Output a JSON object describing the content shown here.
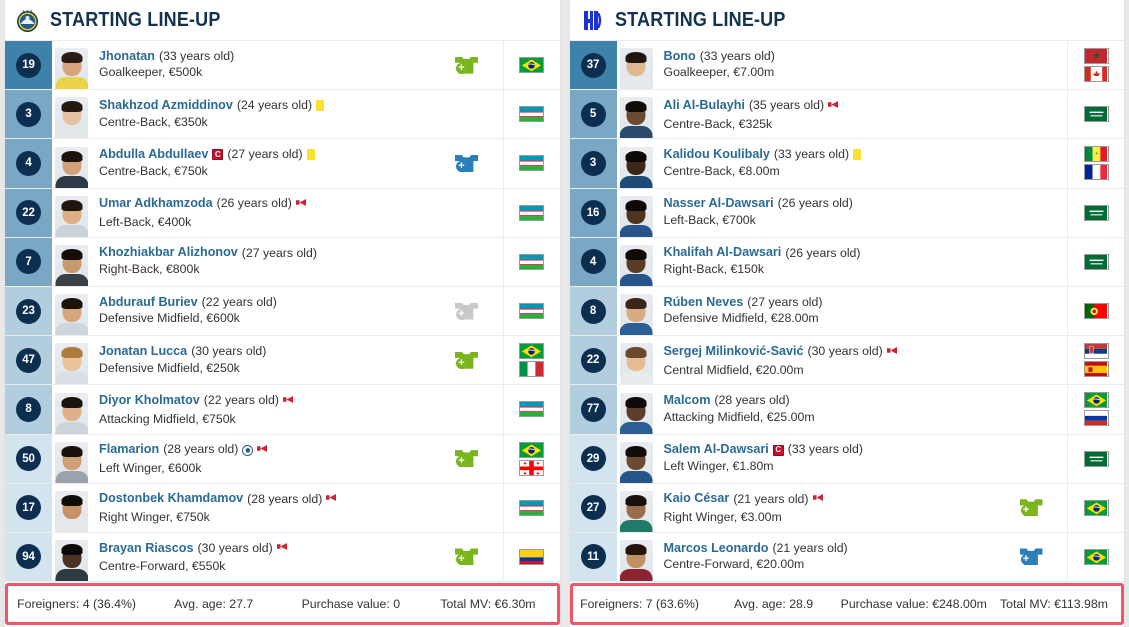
{
  "left_team": {
    "title": "STARTING LINE-UP",
    "crest_icon": "pakhtakor-crest-icon",
    "players": [
      {
        "number": "19",
        "name": "Jhonatan",
        "age": "(33 years old)",
        "position": "Goalkeeper, €500k",
        "pos_group": "gk",
        "sub": "in",
        "flags": [
          "br"
        ],
        "captain": false,
        "yellow": false,
        "arrow": false,
        "goal": false,
        "skin": "#d8a27a",
        "hair": "#2a1c14",
        "shirt": "#e8d34a"
      },
      {
        "number": "3",
        "name": "Shakhzod Azmiddinov",
        "age": "(24 years old)",
        "position": "Centre-Back, €350k",
        "pos_group": "def",
        "sub": null,
        "flags": [
          "uz"
        ],
        "captain": false,
        "yellow": true,
        "arrow": false,
        "goal": false,
        "skin": "#e6c3a0",
        "hair": "#241a12",
        "shirt": "#e2e7ea"
      },
      {
        "number": "4",
        "name": "Abdulla Abdullaev",
        "age": "(27 years old)",
        "position": "Centre-Back, €750k",
        "pos_group": "def",
        "sub": "out",
        "flags": [
          "uz"
        ],
        "captain": true,
        "yellow": true,
        "arrow": false,
        "goal": false,
        "skin": "#d3a079",
        "hair": "#1d140d",
        "shirt": "#2d3a46"
      },
      {
        "number": "22",
        "name": "Umar Adkhamzoda",
        "age": "(26 years old)",
        "position": "Left-Back, €400k",
        "pos_group": "def",
        "sub": null,
        "flags": [
          "uz"
        ],
        "captain": false,
        "yellow": false,
        "arrow": true,
        "goal": false,
        "skin": "#dcae85",
        "hair": "#20160f",
        "shirt": "#c9d2d8"
      },
      {
        "number": "7",
        "name": "Khozhiakbar Alizhonov",
        "age": "(27 years old)",
        "position": "Right-Back, €800k",
        "pos_group": "def",
        "sub": null,
        "flags": [
          "uz"
        ],
        "captain": false,
        "yellow": false,
        "arrow": false,
        "goal": false,
        "skin": "#c99a70",
        "hair": "#140d08",
        "shirt": "#3a3f45"
      },
      {
        "number": "23",
        "name": "Abdurauf Buriev",
        "age": "(22 years old)",
        "position": "Defensive Midfield, €600k",
        "pos_group": "mid",
        "sub": "gray",
        "flags": [
          "uz"
        ],
        "captain": false,
        "yellow": false,
        "arrow": false,
        "goal": false,
        "skin": "#d6a57c",
        "hair": "#1a1109",
        "shirt": "#cfd6db"
      },
      {
        "number": "47",
        "name": "Jonatan Lucca",
        "age": "(30 years old)",
        "position": "Defensive Midfield, €250k",
        "pos_group": "mid",
        "sub": "in",
        "flags": [
          "br",
          "it"
        ],
        "captain": false,
        "yellow": false,
        "arrow": false,
        "goal": false,
        "skin": "#e8c39c",
        "hair": "#b07a3c",
        "shirt": "#d9dfe4"
      },
      {
        "number": "8",
        "name": "Diyor Kholmatov",
        "age": "(22 years old)",
        "position": "Attacking Midfield, €750k",
        "pos_group": "mid",
        "sub": null,
        "flags": [
          "uz"
        ],
        "captain": false,
        "yellow": false,
        "arrow": true,
        "goal": false,
        "skin": "#dfb189",
        "hair": "#1b120b",
        "shirt": "#cdd5da"
      },
      {
        "number": "50",
        "name": "Flamarion",
        "age": "(28 years old)",
        "position": "Left Winger, €600k",
        "pos_group": "att",
        "sub": "in",
        "flags": [
          "br",
          "ge"
        ],
        "captain": false,
        "yellow": false,
        "arrow": true,
        "goal": true,
        "skin": "#cf9f76",
        "hair": "#171008",
        "shirt": "#9aa3ab"
      },
      {
        "number": "17",
        "name": "Dostonbek Khamdamov",
        "age": "(28 years old)",
        "position": "Right Winger, €750k",
        "pos_group": "att",
        "sub": null,
        "flags": [
          "uz"
        ],
        "captain": false,
        "yellow": false,
        "arrow": true,
        "goal": false,
        "skin": "#c79168",
        "hair": "#120c06",
        "shirt": "#e5e9ec"
      },
      {
        "number": "94",
        "name": "Brayan Riascos",
        "age": "(30 years old)",
        "position": "Centre-Forward, €550k",
        "pos_group": "att",
        "sub": "in",
        "flags": [
          "co"
        ],
        "captain": false,
        "yellow": false,
        "arrow": true,
        "goal": false,
        "skin": "#4a3225",
        "hair": "#0d0805",
        "shirt": "#2e3940"
      }
    ],
    "footer": {
      "foreigners": "Foreigners: 4 (36.4%)",
      "avg_age": "Avg. age: 27.7",
      "purchase_value": "Purchase value: 0",
      "total_mv": "Total MV: €6.30m"
    }
  },
  "right_team": {
    "title": "STARTING LINE-UP",
    "crest_icon": "al-hilal-crest-icon",
    "players": [
      {
        "number": "37",
        "name": "Bono",
        "age": "(33 years old)",
        "position": "Goalkeeper, €7.00m",
        "pos_group": "gk",
        "sub": null,
        "flags": [
          "ma",
          "ca"
        ],
        "captain": false,
        "yellow": false,
        "arrow": false,
        "goal": false,
        "skin": "#e0b88f",
        "hair": "#211710",
        "shirt": "#e6eaec"
      },
      {
        "number": "5",
        "name": "Ali Al-Bulayhi",
        "age": "(35 years old)",
        "position": "Centre-Back, €325k",
        "pos_group": "def",
        "sub": null,
        "flags": [
          "sa"
        ],
        "captain": false,
        "yellow": false,
        "arrow": true,
        "goal": false,
        "skin": "#6b4a34",
        "hair": "#120c07",
        "shirt": "#2a4a6b"
      },
      {
        "number": "3",
        "name": "Kalidou Koulibaly",
        "age": "(33 years old)",
        "position": "Centre-Back, €8.00m",
        "pos_group": "def",
        "sub": null,
        "flags": [
          "sn",
          "fr"
        ],
        "captain": false,
        "yellow": true,
        "arrow": false,
        "goal": false,
        "skin": "#3b2719",
        "hair": "#0b0704",
        "shirt": "#1f4b7a"
      },
      {
        "number": "16",
        "name": "Nasser Al-Dawsari",
        "age": "(26 years old)",
        "position": "Left-Back, €700k",
        "pos_group": "def",
        "sub": null,
        "flags": [
          "sa"
        ],
        "captain": false,
        "yellow": false,
        "arrow": false,
        "goal": false,
        "skin": "#4e3522",
        "hair": "#0d0805",
        "shirt": "#27558a"
      },
      {
        "number": "4",
        "name": "Khalifah Al-Dawsari",
        "age": "(26 years old)",
        "position": "Right-Back, €150k",
        "pos_group": "def",
        "sub": null,
        "flags": [
          "sa"
        ],
        "captain": false,
        "yellow": false,
        "arrow": false,
        "goal": false,
        "skin": "#5a3c26",
        "hair": "#100a06",
        "shirt": "#27558a"
      },
      {
        "number": "8",
        "name": "Rúben Neves",
        "age": "(27 years old)",
        "position": "Defensive Midfield, €28.00m",
        "pos_group": "mid",
        "sub": null,
        "flags": [
          "pt"
        ],
        "captain": false,
        "yellow": false,
        "arrow": false,
        "goal": false,
        "skin": "#d8ab83",
        "hair": "#3a2516",
        "shirt": "#2a5e94"
      },
      {
        "number": "22",
        "name": "Sergej Milinković-Savić",
        "age": "(30 years old)",
        "position": "Central Midfield, €20.00m",
        "pos_group": "mid",
        "sub": null,
        "flags": [
          "rs",
          "es"
        ],
        "captain": false,
        "yellow": false,
        "arrow": true,
        "goal": false,
        "skin": "#e4bd95",
        "hair": "#6a4a2c",
        "shirt": "#e8ecee"
      },
      {
        "number": "77",
        "name": "Malcom",
        "age": "(28 years old)",
        "position": "Attacking Midfield, €25.00m",
        "pos_group": "mid",
        "sub": null,
        "flags": [
          "br",
          "ru"
        ],
        "captain": false,
        "yellow": false,
        "arrow": false,
        "goal": false,
        "skin": "#5c3e28",
        "hair": "#0f0a06",
        "shirt": "#2a5e94"
      },
      {
        "number": "29",
        "name": "Salem Al-Dawsari",
        "age": "(33 years old)",
        "position": "Left Winger, €1.80m",
        "pos_group": "att",
        "sub": null,
        "flags": [
          "sa"
        ],
        "captain": true,
        "yellow": false,
        "arrow": false,
        "goal": false,
        "skin": "#6d4a30",
        "hair": "#120c07",
        "shirt": "#27558a"
      },
      {
        "number": "27",
        "name": "Kaio César",
        "age": "(21 years old)",
        "position": "Right Winger, €3.00m",
        "pos_group": "att",
        "sub": "in",
        "flags": [
          "br"
        ],
        "captain": false,
        "yellow": false,
        "arrow": true,
        "goal": false,
        "skin": "#9a6d4a",
        "hair": "#16100a",
        "shirt": "#1f7a6a"
      },
      {
        "number": "11",
        "name": "Marcos Leonardo",
        "age": "(21 years old)",
        "position": "Centre-Forward, €20.00m",
        "pos_group": "att",
        "sub": "out",
        "flags": [
          "br"
        ],
        "captain": false,
        "yellow": false,
        "arrow": false,
        "goal": false,
        "skin": "#c08f63",
        "hair": "#241409",
        "shirt": "#8a2430"
      }
    ],
    "footer": {
      "foreigners": "Foreigners: 7 (63.6%)",
      "avg_age": "Avg. age: 28.9",
      "purchase_value": "Purchase value: €248.00m",
      "total_mv": "Total MV: €113.98m"
    }
  },
  "colors": {
    "accent": "#2a6a94",
    "badge": "#0d2f4f",
    "sub_in": "#7ab51d",
    "sub_out": "#2a7fb8",
    "highlight_border": "#f2556a"
  }
}
